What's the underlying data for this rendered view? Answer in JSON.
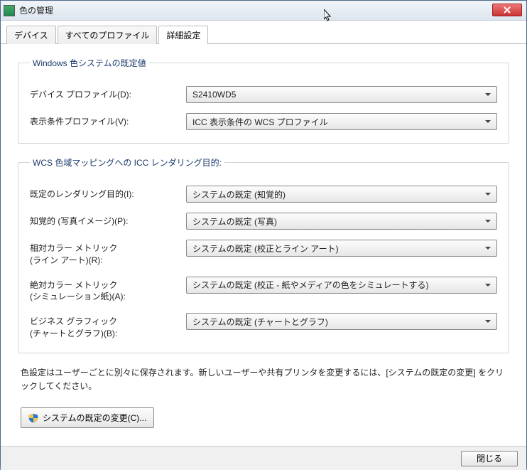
{
  "window": {
    "title": "色の管理"
  },
  "tabs": {
    "device": "デバイス",
    "all_profiles": "すべてのプロファイル",
    "advanced": "詳細設定"
  },
  "group1": {
    "legend": "Windows 色システムの既定値",
    "device_profile_label": "デバイス プロファイル(D):",
    "device_profile_value": "S2410WD5",
    "viewing_conditions_label": "表示条件プロファイル(V):",
    "viewing_conditions_value": "ICC 表示条件の WCS プロファイル"
  },
  "group2": {
    "legend": "WCS 色域マッピングへの ICC レンダリング目的:",
    "default_intent_label": "既定のレンダリング目的(I):",
    "default_intent_value": "システムの既定 (知覚的)",
    "perceptual_label": "知覚的 (写真イメージ)(P):",
    "perceptual_value": "システムの既定 (写真)",
    "relative_label_1": "相対カラー メトリック",
    "relative_label_2": "(ライン アート)(R):",
    "relative_value": "システムの既定 (校正とライン アート)",
    "absolute_label_1": "絶対カラー メトリック",
    "absolute_label_2": "(シミュレーション紙)(A):",
    "absolute_value": "システムの既定 (校正 - 紙やメディアの色をシミュレートする)",
    "business_label_1": "ビジネス グラフィック",
    "business_label_2": "(チャートとグラフ)(B):",
    "business_value": "システムの既定 (チャートとグラフ)"
  },
  "helptext": "色設定はユーザーごとに別々に保存されます。新しいユーザーや共有プリンタを変更するには、[システムの既定の変更] をクリックしてください。",
  "change_defaults_button": "システムの既定の変更(C)...",
  "footer": {
    "close": "閉じる"
  }
}
